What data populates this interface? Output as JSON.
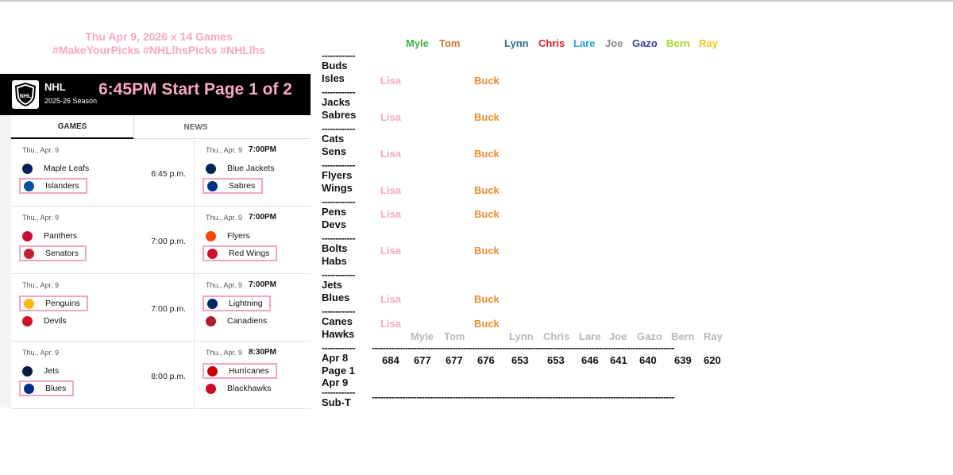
{
  "promo": {
    "line1": "Thu Apr 9, 2026   x 14 Games",
    "line2": "#MakeYourPicks #NHLlhsPicks #NHLlhs"
  },
  "nhl": {
    "name": "NHL",
    "season": "2025-26 Season",
    "start_banner": "6:45PM Start  Page 1 of 2",
    "tabs": [
      "GAMES",
      "NEWS"
    ]
  },
  "games": [
    {
      "date": "Thu., Apr. 9",
      "time_top": "",
      "time_side": "6:45 p.m.",
      "away": "Maple Leafs",
      "home": "Islanders",
      "pick": "home"
    },
    {
      "date": "Thu., Apr. 9",
      "time_top": "7:00PM",
      "time_side": "",
      "away": "Blue Jackets",
      "home": "Sabres",
      "pick": "home"
    },
    {
      "date": "Thu., Apr. 9",
      "time_top": "",
      "time_side": "7:00 p.m.",
      "away": "Panthers",
      "home": "Senators",
      "pick": "home"
    },
    {
      "date": "Thu., Apr. 9",
      "time_top": "7:00PM",
      "time_side": "",
      "away": "Flyers",
      "home": "Red Wings",
      "pick": "home"
    },
    {
      "date": "Thu., Apr. 9",
      "time_top": "",
      "time_side": "7:00 p.m.",
      "away": "Penguins",
      "home": "Devils",
      "pick": "away"
    },
    {
      "date": "Thu., Apr. 9",
      "time_top": "7:00PM",
      "time_side": "",
      "away": "Lightning",
      "home": "Canadiens",
      "pick": "away"
    },
    {
      "date": "Thu., Apr. 9",
      "time_top": "",
      "time_side": "8:00 p.m.",
      "away": "Jets",
      "home": "Blues",
      "pick": "home"
    },
    {
      "date": "Thu., Apr. 9",
      "time_top": "8:30PM",
      "time_side": "",
      "away": "Hurricanes",
      "home": "Blackhawks",
      "pick": "away"
    }
  ],
  "roster_header": [
    {
      "name": "Myle",
      "color": "#3cb043"
    },
    {
      "name": "Tom",
      "color": "#c8763a"
    },
    {
      "name": "Lynn",
      "color": "#2e6f8e"
    },
    {
      "name": "Chris",
      "color": "#e0202a"
    },
    {
      "name": "Lare",
      "color": "#2aa0d8"
    },
    {
      "name": "Joe",
      "color": "#888888"
    },
    {
      "name": "Gazo",
      "color": "#3a3aa8"
    },
    {
      "name": "Bern",
      "color": "#a8d82a"
    },
    {
      "name": "Ray",
      "color": "#f5c518"
    }
  ],
  "matchups": [
    {
      "a": "Buds",
      "b": "Isles",
      "lisa": "Lisa",
      "buck": "Buck"
    },
    {
      "a": "Jacks",
      "b": "Sabres",
      "lisa": "Lisa",
      "buck": "Buck"
    },
    {
      "a": "Cats",
      "b": "Sens",
      "lisa": "Lisa",
      "buck": "Buck"
    },
    {
      "a": "Flyers",
      "b": "Wings",
      "lisa": "Lisa",
      "buck": "Buck"
    },
    {
      "a": "Pens",
      "b": "Devs",
      "lisa": "Lisa",
      "buck": "Buck"
    },
    {
      "a": "Bolts",
      "b": "Habs",
      "lisa": "Lisa",
      "buck": "Buck"
    },
    {
      "a": "Jets",
      "b": "Blues",
      "lisa": "Lisa",
      "buck": "Buck"
    },
    {
      "a": "Canes",
      "b": "Hawks",
      "lisa": "Lisa",
      "buck": "Buck"
    }
  ],
  "standings": {
    "names": [
      "Myle",
      "Tom",
      "Lynn",
      "Chris",
      "Lare",
      "Joe",
      "Gazo",
      "Bern",
      "Ray"
    ],
    "apr8_label": "Apr 8",
    "scores": [
      "684",
      "677",
      "677",
      "676",
      "653",
      "653",
      "646",
      "641",
      "640",
      "639",
      "620"
    ],
    "page_label": "Page 1",
    "apr9_label": "Apr 9",
    "subt_label": "Sub-T",
    "dashes_short": "------------",
    "dashes_long": "-------------------------------------------------------------------------------------------------------------"
  }
}
